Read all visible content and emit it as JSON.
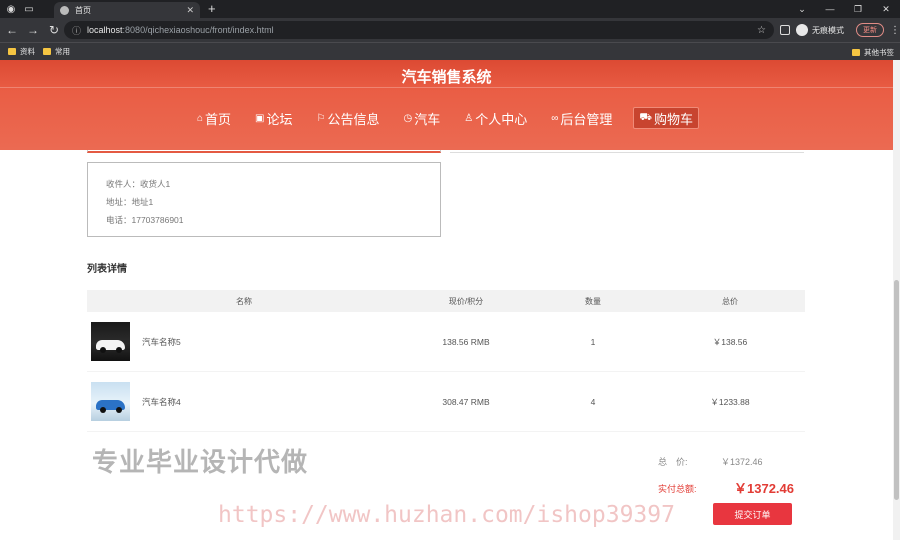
{
  "browser": {
    "tab_title": "首页",
    "url_host": "localhost",
    "url_rest": ":8080/qichexiaoshouc/front/index.html",
    "profile_label": "无痕模式",
    "update_label": "更新",
    "bookmarks": [
      "资料",
      "常用"
    ],
    "other_bookmarks": "其他书签"
  },
  "site": {
    "title": "汽车销售系统",
    "nav": [
      {
        "label": "首页",
        "icon": "home-icon"
      },
      {
        "label": "论坛",
        "icon": "forum-icon"
      },
      {
        "label": "公告信息",
        "icon": "flag-icon"
      },
      {
        "label": "汽车",
        "icon": "clock-icon"
      },
      {
        "label": "个人中心",
        "icon": "user-icon"
      },
      {
        "label": "后台管理",
        "icon": "link-icon"
      },
      {
        "label": "购物车",
        "icon": "cart-icon",
        "active": true
      }
    ],
    "accent_color": "#e45a43"
  },
  "address": {
    "receiver": "收件人：收货人1",
    "addr": "地址：地址1",
    "phone": "电话：17703786901"
  },
  "list": {
    "title": "列表详情",
    "headers": [
      "名称",
      "现价/积分",
      "数量",
      "总价"
    ],
    "rows": [
      {
        "name": "汽车名称5",
        "price": "138.56 RMB",
        "qty": "1",
        "total": "￥138.56"
      },
      {
        "name": "汽车名称4",
        "price": "308.47 RMB",
        "qty": "4",
        "total": "￥1233.88"
      }
    ]
  },
  "summary": {
    "total_label": "总　价:",
    "total_value": "￥1372.46",
    "paid_label": "实付总额:",
    "paid_value": "￥1372.46",
    "submit_label": "提交订单"
  },
  "watermarks": {
    "cn": "专业毕业设计代做",
    "url": "https://www.huzhan.com/ishop39397"
  }
}
